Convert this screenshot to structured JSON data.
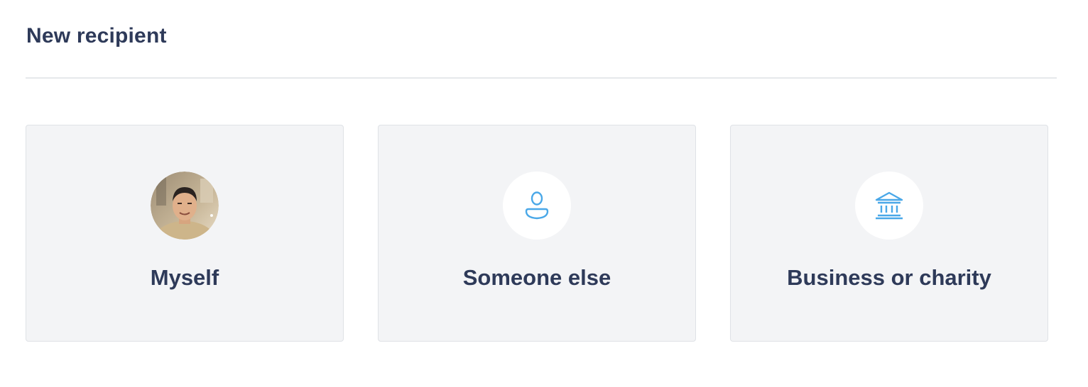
{
  "header": {
    "title": "New recipient"
  },
  "options": [
    {
      "label": "Myself",
      "icon": "avatar"
    },
    {
      "label": "Someone else",
      "icon": "person-icon"
    },
    {
      "label": "Business or charity",
      "icon": "bank-icon"
    }
  ],
  "colors": {
    "text": "#2e3a59",
    "accent_icon": "#4aa8e8",
    "card_bg": "#f3f4f6",
    "card_border": "#dfe2e6",
    "divider": "#e6e8eb"
  }
}
